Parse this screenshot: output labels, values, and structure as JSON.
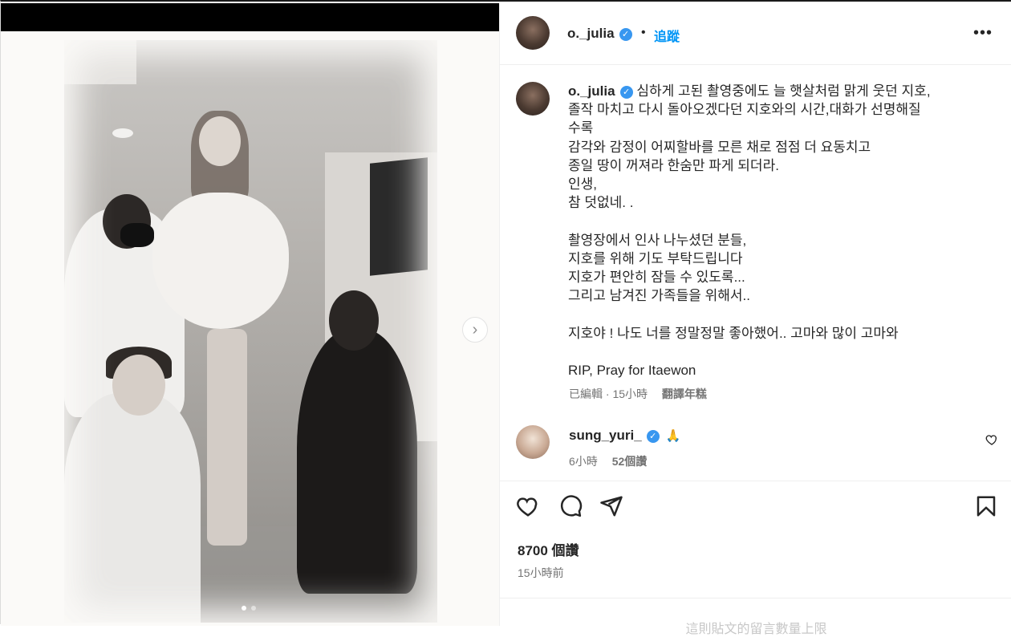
{
  "post": {
    "author": "o._julia",
    "follow_label": "追蹤",
    "separator": "•",
    "more_label": "•••",
    "next_label": "›",
    "caption_lines": [
      "심하게 고된 촬영중에도 늘 햇살처럼 맑게 웃던 지호,",
      "졸작 마치고 다시 돌아오겠다던 지호와의 시간,대화가 선명해질",
      "수록",
      "감각와 감정이 어찌할바를 모른 채로 점점 더 요동치고",
      "종일 땅이 꺼져라 한숨만 파게 되더라.",
      "인생,",
      "참 덧없네. .",
      "",
      "촬영장에서 인사 나누셨던 분들,",
      "지호를 위해 기도 부탁드립니다",
      "지호가 편안히 잠들 수 있도록...",
      "그리고 남겨진 가족들을 위해서..",
      "",
      "지호야 ! 나도 너를 정말정말 좋아했어.. 고마와 많이 고마와",
      "",
      "RIP, Pray for Itaewon"
    ],
    "caption_meta": "已編輯 · 15小時",
    "translate_label": "翻譯年糕",
    "likes": "8700 個讚",
    "time_ago": "15小時前",
    "footer_text": "這則貼文的留言數量上限",
    "media_dots": 2,
    "media_active_dot": 0
  },
  "reply": {
    "author": "sung_yuri_",
    "emoji": "🙏",
    "time": "6小時",
    "likes": "52個讚"
  },
  "icons": {
    "verified": "verified-badge-icon",
    "like": "heart-icon",
    "comment": "comment-icon",
    "share": "share-icon",
    "save": "bookmark-icon",
    "next": "chevron-right-icon",
    "more": "more-options-icon"
  },
  "colors": {
    "link_blue": "#0095f6",
    "verified_blue": "#3897f0",
    "muted": "#737373"
  }
}
